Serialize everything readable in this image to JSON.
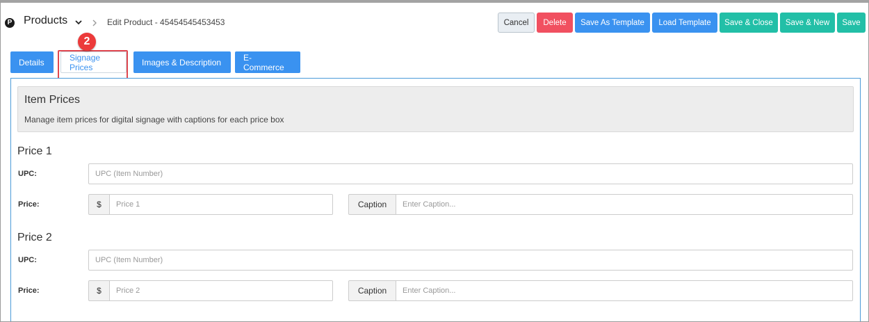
{
  "header": {
    "logo_letter": "P",
    "module_title": "Products",
    "breadcrumb": "Edit Product - 45454545453453"
  },
  "toolbar": {
    "cancel": "Cancel",
    "delete": "Delete",
    "save_as_template": "Save As Template",
    "load_template": "Load Template",
    "save_close": "Save & Close",
    "save_new": "Save & New",
    "save": "Save"
  },
  "tabs": [
    {
      "label": "Details",
      "active": false
    },
    {
      "label": "Signage Prices",
      "active": true
    },
    {
      "label": "Images & Description",
      "active": false
    },
    {
      "label": "E-Commerce",
      "active": false
    }
  ],
  "annotation": {
    "step_number": "2"
  },
  "info": {
    "title": "Item Prices",
    "description": "Manage item prices for digital signage with captions for each price box"
  },
  "prices": [
    {
      "title": "Price 1",
      "upc_label": "UPC:",
      "upc_placeholder": "UPC (Item Number)",
      "price_label": "Price:",
      "currency": "$",
      "price_placeholder": "Price 1",
      "caption_label": "Caption",
      "caption_placeholder": "Enter Caption..."
    },
    {
      "title": "Price 2",
      "upc_label": "UPC:",
      "upc_placeholder": "UPC (Item Number)",
      "price_label": "Price:",
      "currency": "$",
      "price_placeholder": "Price 2",
      "caption_label": "Caption",
      "caption_placeholder": "Enter Caption..."
    }
  ],
  "colors": {
    "primary": "#3a92f0",
    "danger": "#f15060",
    "teal": "#22bfa7",
    "highlight": "#e0474f"
  }
}
